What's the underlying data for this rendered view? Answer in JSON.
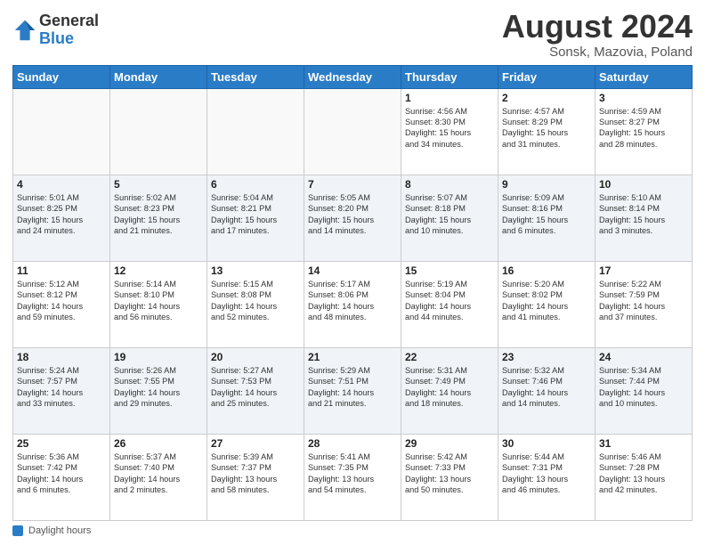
{
  "logo": {
    "general": "General",
    "blue": "Blue"
  },
  "title": "August 2024",
  "subtitle": "Sonsk, Mazovia, Poland",
  "days_of_week": [
    "Sunday",
    "Monday",
    "Tuesday",
    "Wednesday",
    "Thursday",
    "Friday",
    "Saturday"
  ],
  "footer_label": "Daylight hours",
  "weeks": [
    [
      {
        "day": "",
        "info": ""
      },
      {
        "day": "",
        "info": ""
      },
      {
        "day": "",
        "info": ""
      },
      {
        "day": "",
        "info": ""
      },
      {
        "day": "1",
        "info": "Sunrise: 4:56 AM\nSunset: 8:30 PM\nDaylight: 15 hours\nand 34 minutes."
      },
      {
        "day": "2",
        "info": "Sunrise: 4:57 AM\nSunset: 8:29 PM\nDaylight: 15 hours\nand 31 minutes."
      },
      {
        "day": "3",
        "info": "Sunrise: 4:59 AM\nSunset: 8:27 PM\nDaylight: 15 hours\nand 28 minutes."
      }
    ],
    [
      {
        "day": "4",
        "info": "Sunrise: 5:01 AM\nSunset: 8:25 PM\nDaylight: 15 hours\nand 24 minutes."
      },
      {
        "day": "5",
        "info": "Sunrise: 5:02 AM\nSunset: 8:23 PM\nDaylight: 15 hours\nand 21 minutes."
      },
      {
        "day": "6",
        "info": "Sunrise: 5:04 AM\nSunset: 8:21 PM\nDaylight: 15 hours\nand 17 minutes."
      },
      {
        "day": "7",
        "info": "Sunrise: 5:05 AM\nSunset: 8:20 PM\nDaylight: 15 hours\nand 14 minutes."
      },
      {
        "day": "8",
        "info": "Sunrise: 5:07 AM\nSunset: 8:18 PM\nDaylight: 15 hours\nand 10 minutes."
      },
      {
        "day": "9",
        "info": "Sunrise: 5:09 AM\nSunset: 8:16 PM\nDaylight: 15 hours\nand 6 minutes."
      },
      {
        "day": "10",
        "info": "Sunrise: 5:10 AM\nSunset: 8:14 PM\nDaylight: 15 hours\nand 3 minutes."
      }
    ],
    [
      {
        "day": "11",
        "info": "Sunrise: 5:12 AM\nSunset: 8:12 PM\nDaylight: 14 hours\nand 59 minutes."
      },
      {
        "day": "12",
        "info": "Sunrise: 5:14 AM\nSunset: 8:10 PM\nDaylight: 14 hours\nand 56 minutes."
      },
      {
        "day": "13",
        "info": "Sunrise: 5:15 AM\nSunset: 8:08 PM\nDaylight: 14 hours\nand 52 minutes."
      },
      {
        "day": "14",
        "info": "Sunrise: 5:17 AM\nSunset: 8:06 PM\nDaylight: 14 hours\nand 48 minutes."
      },
      {
        "day": "15",
        "info": "Sunrise: 5:19 AM\nSunset: 8:04 PM\nDaylight: 14 hours\nand 44 minutes."
      },
      {
        "day": "16",
        "info": "Sunrise: 5:20 AM\nSunset: 8:02 PM\nDaylight: 14 hours\nand 41 minutes."
      },
      {
        "day": "17",
        "info": "Sunrise: 5:22 AM\nSunset: 7:59 PM\nDaylight: 14 hours\nand 37 minutes."
      }
    ],
    [
      {
        "day": "18",
        "info": "Sunrise: 5:24 AM\nSunset: 7:57 PM\nDaylight: 14 hours\nand 33 minutes."
      },
      {
        "day": "19",
        "info": "Sunrise: 5:26 AM\nSunset: 7:55 PM\nDaylight: 14 hours\nand 29 minutes."
      },
      {
        "day": "20",
        "info": "Sunrise: 5:27 AM\nSunset: 7:53 PM\nDaylight: 14 hours\nand 25 minutes."
      },
      {
        "day": "21",
        "info": "Sunrise: 5:29 AM\nSunset: 7:51 PM\nDaylight: 14 hours\nand 21 minutes."
      },
      {
        "day": "22",
        "info": "Sunrise: 5:31 AM\nSunset: 7:49 PM\nDaylight: 14 hours\nand 18 minutes."
      },
      {
        "day": "23",
        "info": "Sunrise: 5:32 AM\nSunset: 7:46 PM\nDaylight: 14 hours\nand 14 minutes."
      },
      {
        "day": "24",
        "info": "Sunrise: 5:34 AM\nSunset: 7:44 PM\nDaylight: 14 hours\nand 10 minutes."
      }
    ],
    [
      {
        "day": "25",
        "info": "Sunrise: 5:36 AM\nSunset: 7:42 PM\nDaylight: 14 hours\nand 6 minutes."
      },
      {
        "day": "26",
        "info": "Sunrise: 5:37 AM\nSunset: 7:40 PM\nDaylight: 14 hours\nand 2 minutes."
      },
      {
        "day": "27",
        "info": "Sunrise: 5:39 AM\nSunset: 7:37 PM\nDaylight: 13 hours\nand 58 minutes."
      },
      {
        "day": "28",
        "info": "Sunrise: 5:41 AM\nSunset: 7:35 PM\nDaylight: 13 hours\nand 54 minutes."
      },
      {
        "day": "29",
        "info": "Sunrise: 5:42 AM\nSunset: 7:33 PM\nDaylight: 13 hours\nand 50 minutes."
      },
      {
        "day": "30",
        "info": "Sunrise: 5:44 AM\nSunset: 7:31 PM\nDaylight: 13 hours\nand 46 minutes."
      },
      {
        "day": "31",
        "info": "Sunrise: 5:46 AM\nSunset: 7:28 PM\nDaylight: 13 hours\nand 42 minutes."
      }
    ]
  ]
}
